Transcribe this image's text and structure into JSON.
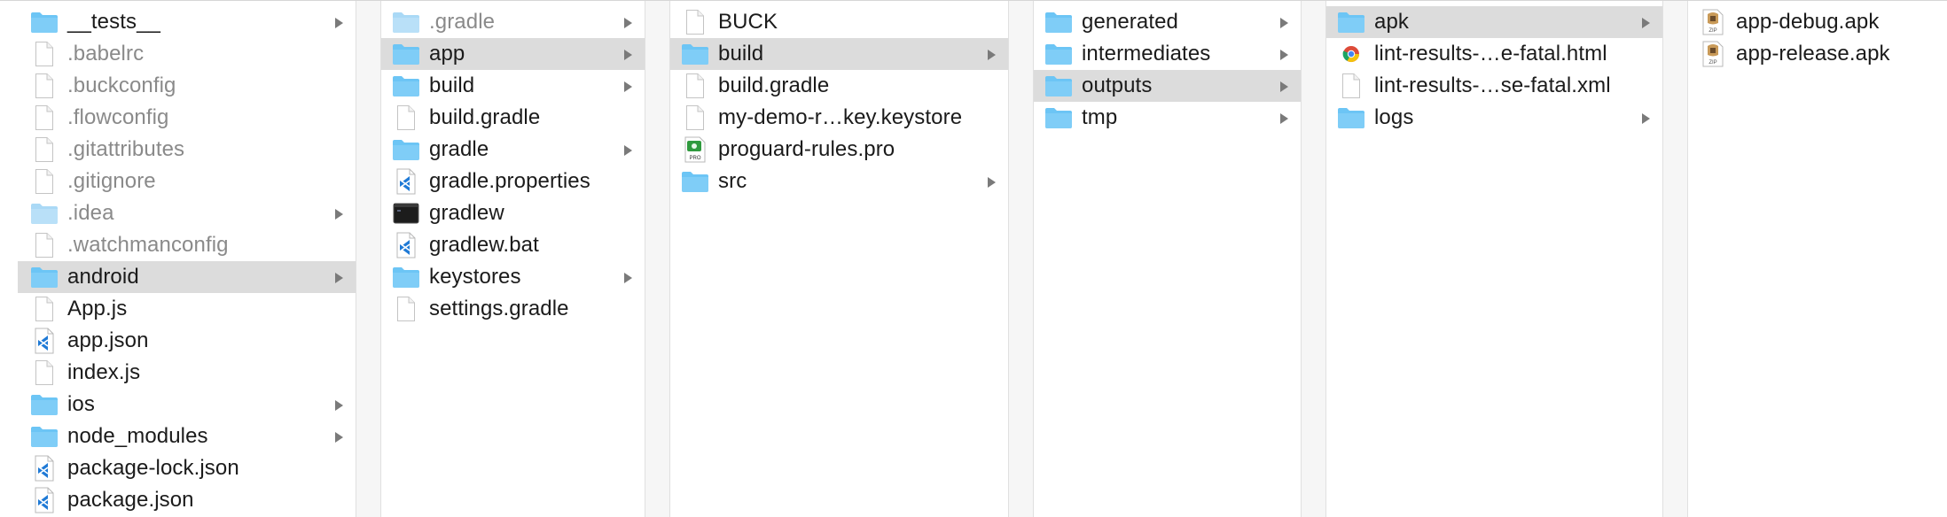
{
  "window": {
    "title": ""
  },
  "colors": {
    "selection": "#dcdcdc",
    "folder": "#6cc5f5",
    "folder_light": "#aad9f6",
    "text": "#1b1b1b",
    "hidden_text": "#8a8a8a",
    "vscode_blue": "#1f7ad6"
  },
  "columns": [
    {
      "items": [
        {
          "label": "__tests__",
          "kind": "folder",
          "hidden": false,
          "selected": false,
          "expandable": true
        },
        {
          "label": ".babelrc",
          "kind": "doc",
          "hidden": true,
          "selected": false,
          "expandable": false
        },
        {
          "label": ".buckconfig",
          "kind": "doc",
          "hidden": true,
          "selected": false,
          "expandable": false
        },
        {
          "label": ".flowconfig",
          "kind": "doc",
          "hidden": true,
          "selected": false,
          "expandable": false
        },
        {
          "label": ".gitattributes",
          "kind": "doc",
          "hidden": true,
          "selected": false,
          "expandable": false
        },
        {
          "label": ".gitignore",
          "kind": "doc",
          "hidden": true,
          "selected": false,
          "expandable": false
        },
        {
          "label": ".idea",
          "kind": "folder",
          "hidden": true,
          "selected": false,
          "expandable": true
        },
        {
          "label": ".watchmanconfig",
          "kind": "doc",
          "hidden": true,
          "selected": false,
          "expandable": false
        },
        {
          "label": "android",
          "kind": "folder",
          "hidden": false,
          "selected": true,
          "expandable": true
        },
        {
          "label": "App.js",
          "kind": "doc",
          "hidden": false,
          "selected": false,
          "expandable": false
        },
        {
          "label": "app.json",
          "kind": "vscode",
          "hidden": false,
          "selected": false,
          "expandable": false
        },
        {
          "label": "index.js",
          "kind": "doc",
          "hidden": false,
          "selected": false,
          "expandable": false
        },
        {
          "label": "ios",
          "kind": "folder",
          "hidden": false,
          "selected": false,
          "expandable": true
        },
        {
          "label": "node_modules",
          "kind": "folder",
          "hidden": false,
          "selected": false,
          "expandable": true
        },
        {
          "label": "package-lock.json",
          "kind": "vscode",
          "hidden": false,
          "selected": false,
          "expandable": false
        },
        {
          "label": "package.json",
          "kind": "vscode",
          "hidden": false,
          "selected": false,
          "expandable": false
        }
      ]
    },
    {
      "items": [
        {
          "label": ".gradle",
          "kind": "folder",
          "hidden": true,
          "selected": false,
          "expandable": true
        },
        {
          "label": "app",
          "kind": "folder",
          "hidden": false,
          "selected": true,
          "expandable": true
        },
        {
          "label": "build",
          "kind": "folder",
          "hidden": false,
          "selected": false,
          "expandable": true
        },
        {
          "label": "build.gradle",
          "kind": "doc",
          "hidden": false,
          "selected": false,
          "expandable": false
        },
        {
          "label": "gradle",
          "kind": "folder",
          "hidden": false,
          "selected": false,
          "expandable": true
        },
        {
          "label": "gradle.properties",
          "kind": "vscode",
          "hidden": false,
          "selected": false,
          "expandable": false
        },
        {
          "label": "gradlew",
          "kind": "terminal",
          "hidden": false,
          "selected": false,
          "expandable": false
        },
        {
          "label": "gradlew.bat",
          "kind": "vscode",
          "hidden": false,
          "selected": false,
          "expandable": false
        },
        {
          "label": "keystores",
          "kind": "folder",
          "hidden": false,
          "selected": false,
          "expandable": true
        },
        {
          "label": "settings.gradle",
          "kind": "doc",
          "hidden": false,
          "selected": false,
          "expandable": false
        }
      ]
    },
    {
      "items": [
        {
          "label": "BUCK",
          "kind": "doc",
          "hidden": false,
          "selected": false,
          "expandable": false
        },
        {
          "label": "build",
          "kind": "folder",
          "hidden": false,
          "selected": true,
          "expandable": true
        },
        {
          "label": "build.gradle",
          "kind": "doc",
          "hidden": false,
          "selected": false,
          "expandable": false
        },
        {
          "label": "my-demo-r…key.keystore",
          "kind": "doc",
          "hidden": false,
          "selected": false,
          "expandable": false
        },
        {
          "label": "proguard-rules.pro",
          "kind": "pro",
          "hidden": false,
          "selected": false,
          "expandable": false
        },
        {
          "label": "src",
          "kind": "folder",
          "hidden": false,
          "selected": false,
          "expandable": true
        }
      ]
    },
    {
      "items": [
        {
          "label": "generated",
          "kind": "folder",
          "hidden": false,
          "selected": false,
          "expandable": true
        },
        {
          "label": "intermediates",
          "kind": "folder",
          "hidden": false,
          "selected": false,
          "expandable": true
        },
        {
          "label": "outputs",
          "kind": "folder",
          "hidden": false,
          "selected": true,
          "expandable": true
        },
        {
          "label": "tmp",
          "kind": "folder",
          "hidden": false,
          "selected": false,
          "expandable": true
        }
      ]
    },
    {
      "items": [
        {
          "label": "apk",
          "kind": "folder",
          "hidden": false,
          "selected": true,
          "expandable": true
        },
        {
          "label": "lint-results-…e-fatal.html",
          "kind": "chrome",
          "hidden": false,
          "selected": false,
          "expandable": false
        },
        {
          "label": "lint-results-…se-fatal.xml",
          "kind": "doc",
          "hidden": false,
          "selected": false,
          "expandable": false
        },
        {
          "label": "logs",
          "kind": "folder",
          "hidden": false,
          "selected": false,
          "expandable": true
        }
      ]
    },
    {
      "items": [
        {
          "label": "app-debug.apk",
          "kind": "apk",
          "hidden": false,
          "selected": false,
          "expandable": false
        },
        {
          "label": "app-release.apk",
          "kind": "apk",
          "hidden": false,
          "selected": false,
          "expandable": false
        }
      ]
    }
  ]
}
